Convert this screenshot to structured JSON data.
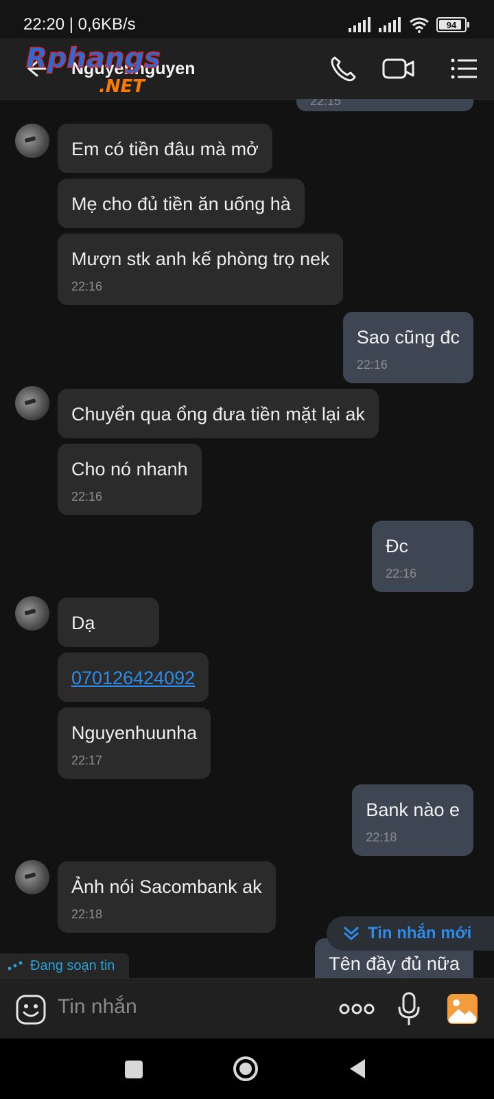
{
  "status": {
    "time_speed": "22:20 | 0,6KB/s",
    "battery": "94"
  },
  "header": {
    "contact_name": "Nguyennguyen",
    "watermark_main": "Rphangs",
    "watermark_sub": ".NET"
  },
  "partial_top_time": "22:15",
  "messages": [
    {
      "dir": "in",
      "text": "Em có tiền đâu mà mở",
      "time": ""
    },
    {
      "dir": "in",
      "text": "Mẹ cho đủ tiền ăn uống hà",
      "time": ""
    },
    {
      "dir": "in",
      "text": "Mượn stk anh kế phòng trọ nek",
      "time": "22:16"
    },
    {
      "dir": "out",
      "text": "Sao cũng đc",
      "time": "22:16"
    },
    {
      "dir": "in",
      "text": "Chuyển qua ổng đưa tiền mặt lại ak",
      "time": ""
    },
    {
      "dir": "in",
      "text": "Cho nó nhanh",
      "time": "22:16"
    },
    {
      "dir": "out",
      "text": "Đc",
      "time": "22:16"
    },
    {
      "dir": "in",
      "text": "Dạ",
      "time": ""
    },
    {
      "dir": "in",
      "text": "070126424092",
      "time": ""
    },
    {
      "dir": "in",
      "text": "Nguyenhuunha",
      "time": "22:17"
    },
    {
      "dir": "out",
      "text": "Bank nào e",
      "time": "22:18"
    },
    {
      "dir": "in",
      "text": "Ảnh nói Sacombank ak",
      "time": "22:18"
    },
    {
      "dir": "out",
      "text": "Tên đầy đủ nữa",
      "time": ""
    }
  ],
  "new_messages_label": "Tin nhắn mới",
  "typing_label": "Đang soạn tin",
  "input": {
    "placeholder": "Tin nhắn"
  },
  "icons": {
    "back": "back-arrow-icon",
    "call": "phone-icon",
    "video": "video-camera-icon",
    "menu": "list-menu-icon",
    "emoji": "emoji-icon",
    "more": "more-dots-icon",
    "mic": "microphone-icon",
    "gallery": "gallery-icon",
    "nav_recent": "square-recents-icon",
    "nav_home": "circle-home-icon",
    "nav_back": "triangle-back-icon"
  },
  "colors": {
    "link": "#2d8bea",
    "incoming_bubble": "#2b2b2b",
    "outgoing_bubble": "#3f4653",
    "gallery": "#f39c3d"
  }
}
